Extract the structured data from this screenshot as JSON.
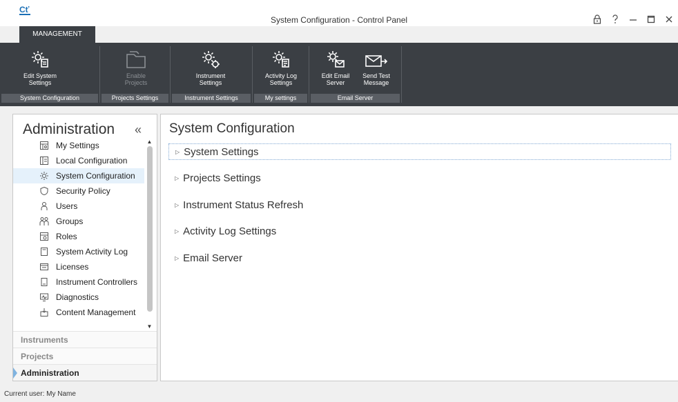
{
  "window": {
    "title": "System Configuration - Control Panel",
    "logo_text": "Cť"
  },
  "ribbon": {
    "tab_label": "MANAGEMENT",
    "buttons": {
      "edit_system_settings": [
        "Edit System",
        "Settings"
      ],
      "enable_projects": [
        "Enable",
        "Projects"
      ],
      "instrument_settings": [
        "Instrument",
        "Settings"
      ],
      "activity_log_settings": [
        "Activity Log",
        "Settings"
      ],
      "edit_email_server": [
        "Edit Email",
        "Server"
      ],
      "send_test_message": [
        "Send Test",
        "Message"
      ]
    },
    "groups": {
      "system_configuration": "System Configuration",
      "projects_settings": "Projects Settings",
      "instrument_settings": "Instrument Settings",
      "my_settings": "My settings",
      "email_server": "Email Server"
    }
  },
  "sidebar": {
    "title": "Administration",
    "collapse_glyph": "«",
    "items": [
      {
        "label": "My Settings",
        "icon": "my-settings-icon"
      },
      {
        "label": "Local Configuration",
        "icon": "local-configuration-icon"
      },
      {
        "label": "System Configuration",
        "icon": "gear-icon",
        "selected": true
      },
      {
        "label": "Security Policy",
        "icon": "shield-icon"
      },
      {
        "label": "Users",
        "icon": "user-icon"
      },
      {
        "label": "Groups",
        "icon": "groups-icon"
      },
      {
        "label": "Roles",
        "icon": "roles-icon"
      },
      {
        "label": "System Activity Log",
        "icon": "log-icon"
      },
      {
        "label": "Licenses",
        "icon": "license-icon"
      },
      {
        "label": "Instrument Controllers",
        "icon": "controller-icon"
      },
      {
        "label": "Diagnostics",
        "icon": "diagnostics-icon"
      },
      {
        "label": "Content Management",
        "icon": "content-management-icon"
      }
    ],
    "sections": {
      "instruments": "Instruments",
      "projects": "Projects",
      "administration": "Administration"
    }
  },
  "main": {
    "title": "System Configuration",
    "sections": [
      "System Settings",
      "Projects Settings",
      "Instrument Status Refresh",
      "Activity Log Settings",
      "Email Server"
    ]
  },
  "status": {
    "current_user": "Current user: My Name"
  },
  "colors": {
    "ribbon_bg": "#3b3f44",
    "group_label_bg": "#5a5e64",
    "selected_item_bg": "#e5f1fb",
    "focus_outline": "#7fa7d3"
  }
}
